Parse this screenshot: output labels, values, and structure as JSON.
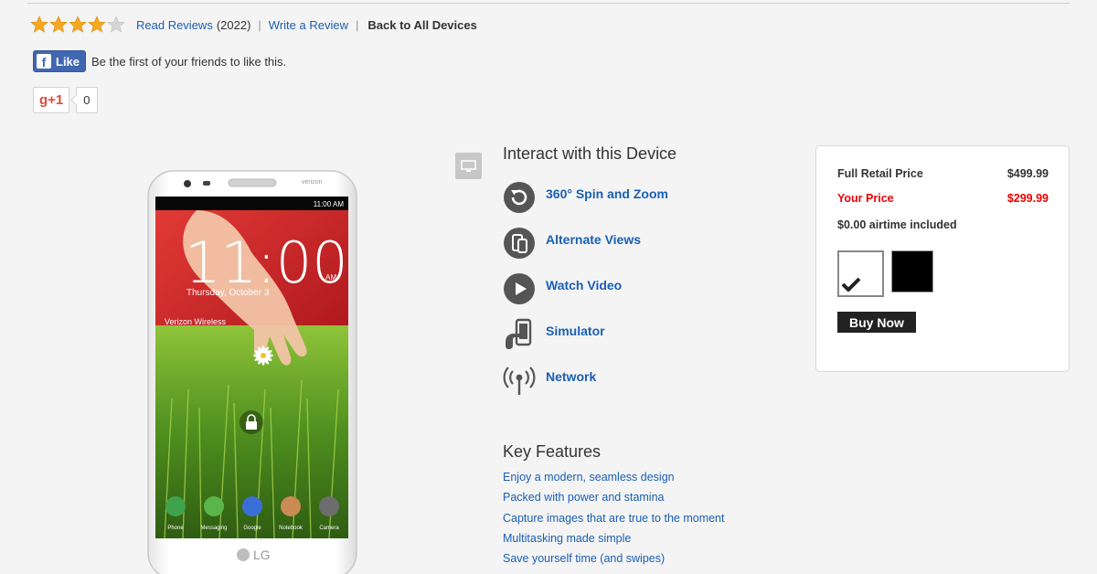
{
  "rating": {
    "stars_filled": 4,
    "stars_total": 5,
    "read_reviews_label": "Read Reviews",
    "review_count": "(2022)",
    "write_review_label": "Write a Review",
    "separator": "|",
    "back_label": "Back to All Devices"
  },
  "facebook": {
    "like_label": "Like",
    "logo_glyph": "f",
    "social_text": "Be the first of your friends to like this."
  },
  "gplus": {
    "label": "g+1",
    "count": "0"
  },
  "phone": {
    "carrier_badge": "verizon",
    "status_time": "11:00 AM",
    "clock": "11:00",
    "clock_ampm": "AM",
    "date": "Thursday, October 3",
    "carrier_text": "Verizon Wireless",
    "brand": "LG",
    "dock": [
      "Phone",
      "Messaging",
      "Google",
      "Notebook",
      "Camera"
    ]
  },
  "interact": {
    "title": "Interact with this Device",
    "items": [
      {
        "label": "360° Spin and Zoom",
        "icon": "rotate-icon"
      },
      {
        "label": "Alternate Views",
        "icon": "phones-icon"
      },
      {
        "label": "Watch Video",
        "icon": "play-icon"
      },
      {
        "label": "Simulator",
        "icon": "hand-phone-icon"
      },
      {
        "label": "Network",
        "icon": "antenna-icon"
      }
    ]
  },
  "features": {
    "title": "Key Features",
    "items": [
      "Enjoy a modern, seamless design",
      "Packed with power and stamina",
      "Capture images that are true to the moment",
      "Multitasking made simple",
      "Save yourself time (and swipes)"
    ]
  },
  "pricing": {
    "retail_label": "Full Retail Price",
    "retail_value": "$499.99",
    "your_label": "Your Price",
    "your_value": "$299.99",
    "airtime": "$0.00 airtime included",
    "buy_label": "Buy Now",
    "colors": {
      "accent_red": "#ee0000",
      "swatch_white": "#ffffff",
      "swatch_black": "#000000"
    }
  }
}
